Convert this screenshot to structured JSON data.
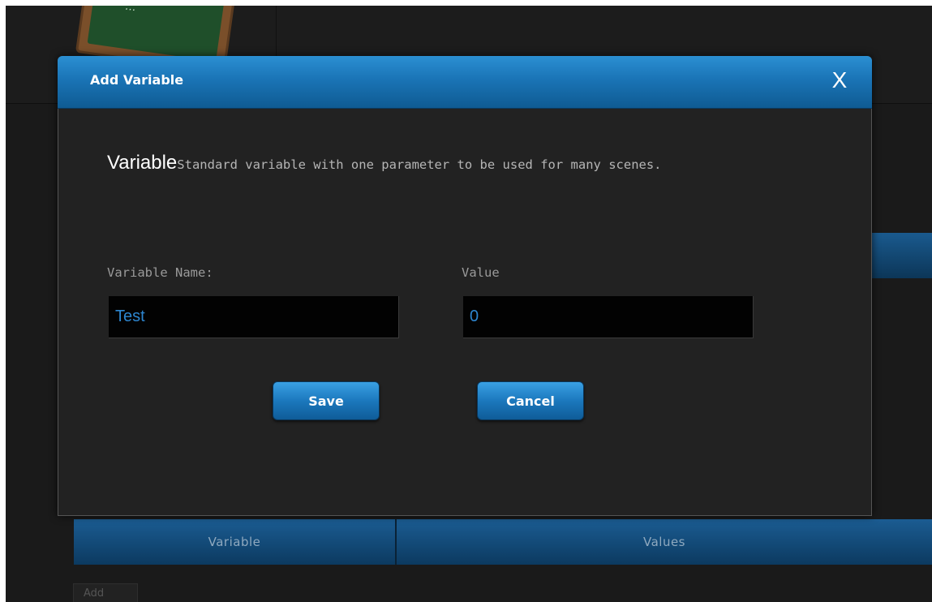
{
  "background": {
    "logo_text": "…",
    "table": {
      "columns": [
        "Variable",
        "Values"
      ]
    },
    "add_button": "Add"
  },
  "modal": {
    "title": "Add Variable",
    "close_label": "X",
    "description": {
      "title": "Variable",
      "text": "Standard variable with one parameter to be used for many scenes."
    },
    "fields": {
      "name_label": "Variable Name:",
      "name_value": "Test",
      "value_label": "Value",
      "value_value": "0"
    },
    "buttons": {
      "save": "Save",
      "cancel": "Cancel"
    }
  },
  "colors": {
    "header_blue": "#1a74b6",
    "input_text": "#2d86d0",
    "modal_bg": "#222222"
  }
}
